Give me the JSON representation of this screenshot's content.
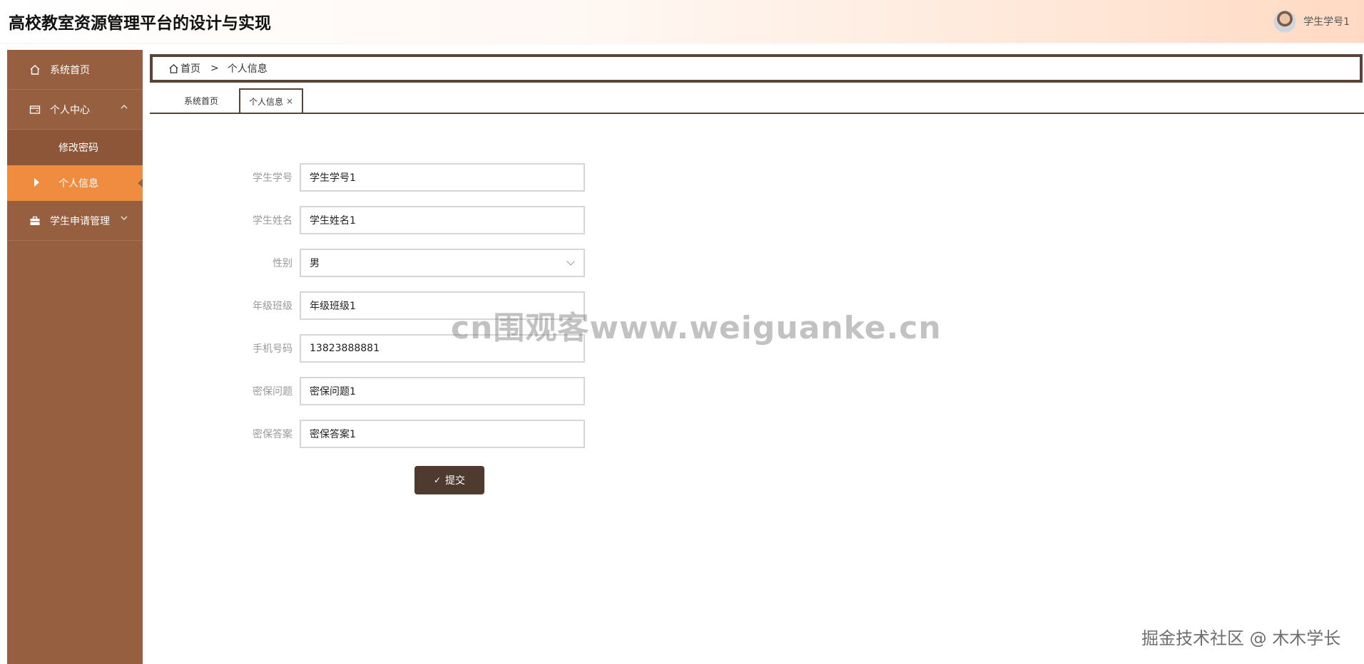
{
  "header": {
    "title": "高校教室资源管理平台的设计与实现",
    "user_name": "学生学号1"
  },
  "sidebar": {
    "items": [
      {
        "label": "系统首页",
        "icon": "home-icon"
      },
      {
        "label": "个人中心",
        "icon": "wallet-icon",
        "expanded": true,
        "children": [
          {
            "label": "修改密码"
          },
          {
            "label": "个人信息",
            "active": true
          }
        ]
      },
      {
        "label": "学生申请管理",
        "icon": "briefcase-icon",
        "expanded": false
      }
    ]
  },
  "breadcrumb": {
    "home": "首页",
    "separator": ">",
    "current": "个人信息"
  },
  "tabs": [
    {
      "label": "系统首页",
      "active": false
    },
    {
      "label": "个人信息",
      "active": true,
      "close": "×"
    }
  ],
  "form": {
    "fields": [
      {
        "label": "学生学号",
        "value": "学生学号1"
      },
      {
        "label": "学生姓名",
        "value": "学生姓名1"
      },
      {
        "label": "性别",
        "value": "男",
        "type": "select"
      },
      {
        "label": "年级班级",
        "value": "年级班级1"
      },
      {
        "label": "手机号码",
        "value": "13823888881"
      },
      {
        "label": "密保问题",
        "value": "密保问题1"
      },
      {
        "label": "密保答案",
        "value": "密保答案1"
      }
    ],
    "submit_label": "提交"
  },
  "watermarks": {
    "center": "cn围观客www.weiguanke.cn",
    "corner": "掘金技术社区 @ 木木学长"
  },
  "colors": {
    "sidebar": "#965f40",
    "sidebar_active": "#f08c40",
    "accent_dark": "#5a4337",
    "button": "#4e3a2f"
  }
}
